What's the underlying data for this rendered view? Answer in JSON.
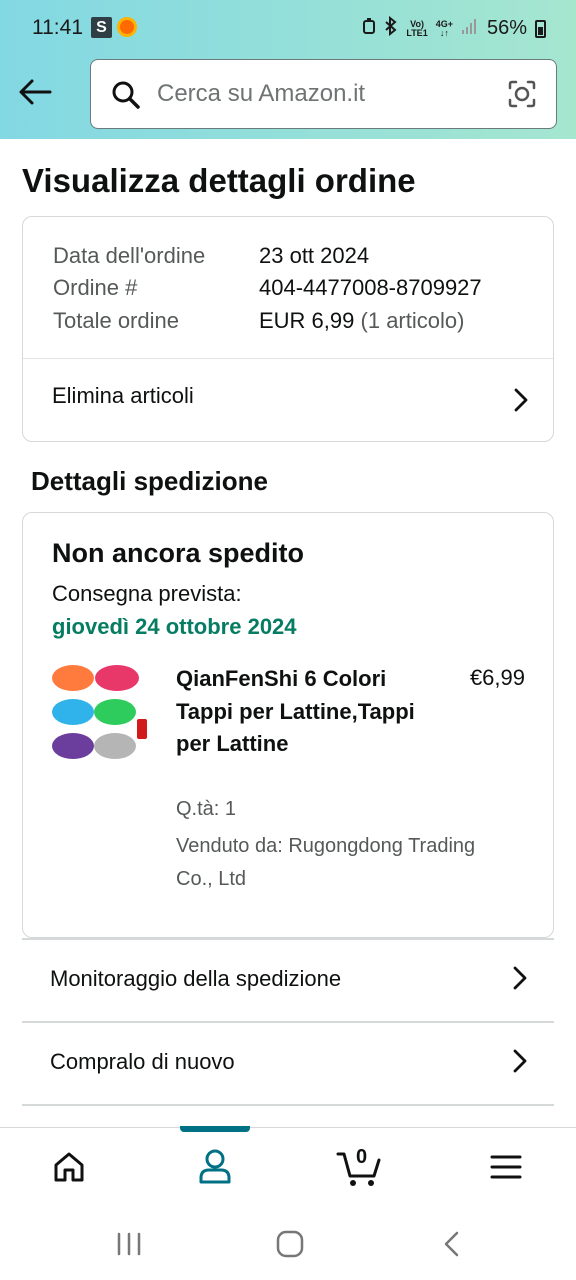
{
  "status_bar": {
    "time": "11:41",
    "app_badge": "S",
    "net_top": "Vo)",
    "net_bottom": "LTE1",
    "net_type": "4G+",
    "battery": "56%"
  },
  "search": {
    "placeholder": "Cerca su Amazon.it"
  },
  "page_title": "Visualizza dettagli ordine",
  "order_summary": {
    "date_label": "Data dell'ordine",
    "date_value": "23 ott 2024",
    "number_label": "Ordine #",
    "number_value": "404-4477008-8709927",
    "total_label": "Totale ordine",
    "total_value": "EUR 6,99",
    "total_items": "(1 articolo)",
    "delete_items": "Elimina articoli"
  },
  "shipping": {
    "section_title": "Dettagli spedizione",
    "status": "Non ancora spedito",
    "delivery_label": "Consegna prevista:",
    "delivery_date": "giovedì 24 ottobre 2024",
    "item": {
      "name": "QianFenShi 6 Colori Tappi per Lattine,Tappi per Lattine",
      "price": "€6,99",
      "quantity": "Q.tà: 1",
      "seller": "Venduto da: Rugongdong Trading Co., Ltd"
    }
  },
  "actions": {
    "track": "Monitoraggio della spedizione",
    "buy_again": "Compralo di nuovo"
  },
  "bottom_nav": {
    "cart_count": "0",
    "active_tab": "account"
  },
  "colors": {
    "header_gradient_start": "#82d8e3",
    "header_gradient_end": "#a5e6cf",
    "delivery_green": "#067d62",
    "active_teal": "#007185"
  },
  "product_cap_colors": [
    "#ff7a3d",
    "#e8386a",
    "#2fb3ea",
    "#2ecc5c",
    "#6b3e9e",
    "#b5b5b5"
  ]
}
